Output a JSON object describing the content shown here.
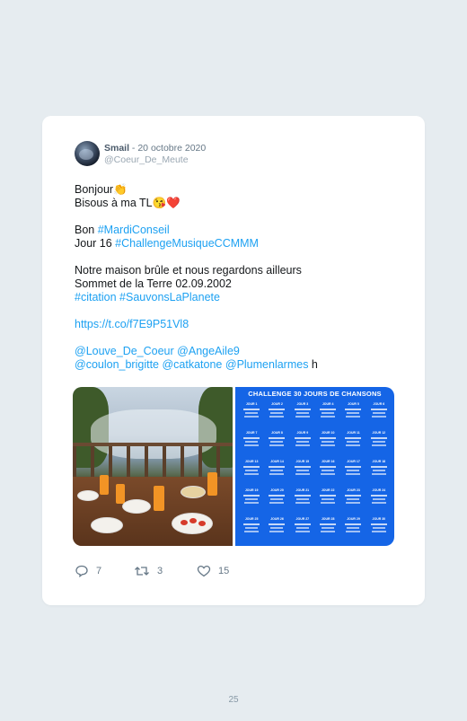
{
  "tweet": {
    "author_name": "Smail",
    "separator_date": " - 20 octobre 2020",
    "handle": "@Coeur_De_Meute",
    "lines": {
      "l1": "Bonjour👏",
      "l2": "Bisous à ma TL😘❤️",
      "l3_prefix": "Bon ",
      "l3_tag": "#MardiConseil",
      "l4_prefix": "Jour 16 ",
      "l4_tag": "#ChallengeMusiqueCCMMM",
      "l5": "Notre maison brûle et nous regardons ailleurs",
      "l6": "Sommet de la Terre 02.09.2002",
      "l7_tag1": "#citation",
      "l7_space": " ",
      "l7_tag2": "#SauvonsLaPlanete",
      "l8_url": "https://t.co/f7E9P51Vl8",
      "m1": "@Louve_De_Coeur",
      "m2": "@AngeAile9",
      "m3": "@coulon_brigitte",
      "m4": "@catkatone",
      "m5": "@Plumenlarmes",
      "m_tail": " h"
    },
    "poster_title": "CHALLENGE 30 JOURS DE CHANSONS",
    "poster_days": [
      "JOUR 1",
      "JOUR 2",
      "JOUR 3",
      "JOUR 4",
      "JOUR 5",
      "JOUR 6",
      "JOUR 7",
      "JOUR 8",
      "JOUR 9",
      "JOUR 10",
      "JOUR 11",
      "JOUR 12",
      "JOUR 13",
      "JOUR 14",
      "JOUR 15",
      "JOUR 16",
      "JOUR 17",
      "JOUR 18",
      "JOUR 19",
      "JOUR 20",
      "JOUR 21",
      "JOUR 22",
      "JOUR 23",
      "JOUR 24",
      "JOUR 25",
      "JOUR 26",
      "JOUR 27",
      "JOUR 28",
      "JOUR 29",
      "JOUR 30"
    ],
    "replies": "7",
    "retweets": "3",
    "likes": "15"
  },
  "page_number": "25",
  "colors": {
    "link": "#1da1f2",
    "poster_blue": "#1565e6",
    "background": "#e6ecf0"
  }
}
